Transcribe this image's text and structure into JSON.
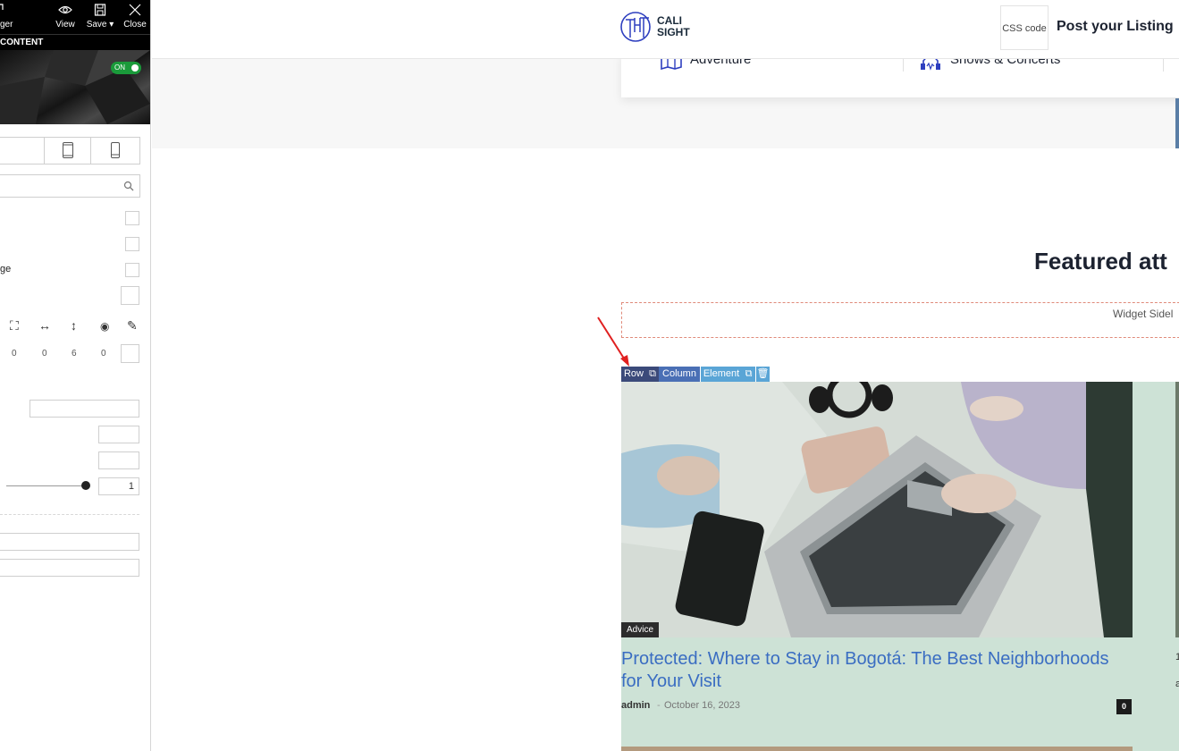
{
  "editor": {
    "toolbar": {
      "manager_fragment": "ger",
      "view_label": "View",
      "save_label": "Save",
      "save_caret": "▾",
      "close_label": "Close"
    },
    "content_tab": "CONTENT",
    "toggle_label": "ON",
    "option_fragment": "ge",
    "numbers": [
      "0",
      "0",
      "6",
      "0"
    ],
    "slider_value": "1"
  },
  "site": {
    "logo": {
      "line1": "CALI",
      "line2": "SIGHT"
    },
    "css_code_label": "CSS code",
    "post_listing": "Post your Listing",
    "categories": [
      {
        "label": "Adventure",
        "icon": "map-icon"
      },
      {
        "label": "Shows & Concerts",
        "icon": "concert-icon"
      }
    ],
    "featured_heading": "Featured att",
    "widget_label": "Widget Sidel",
    "edit_bar": {
      "row": "Row",
      "column": "Column",
      "element": "Element"
    },
    "post": {
      "category": "Advice",
      "title": "Protected: Where to Stay in Bogotá: The Best Neighborhoods for Your Visit",
      "author": "admin",
      "separator": "-",
      "date": "October 16, 2023",
      "comments": "0"
    },
    "next_fragments": [
      "1",
      "a"
    ]
  },
  "colors": {
    "accent_blue": "#3a6dc2",
    "card_overlay": "#cde2d6",
    "toggle_green": "#1a9a3a"
  }
}
